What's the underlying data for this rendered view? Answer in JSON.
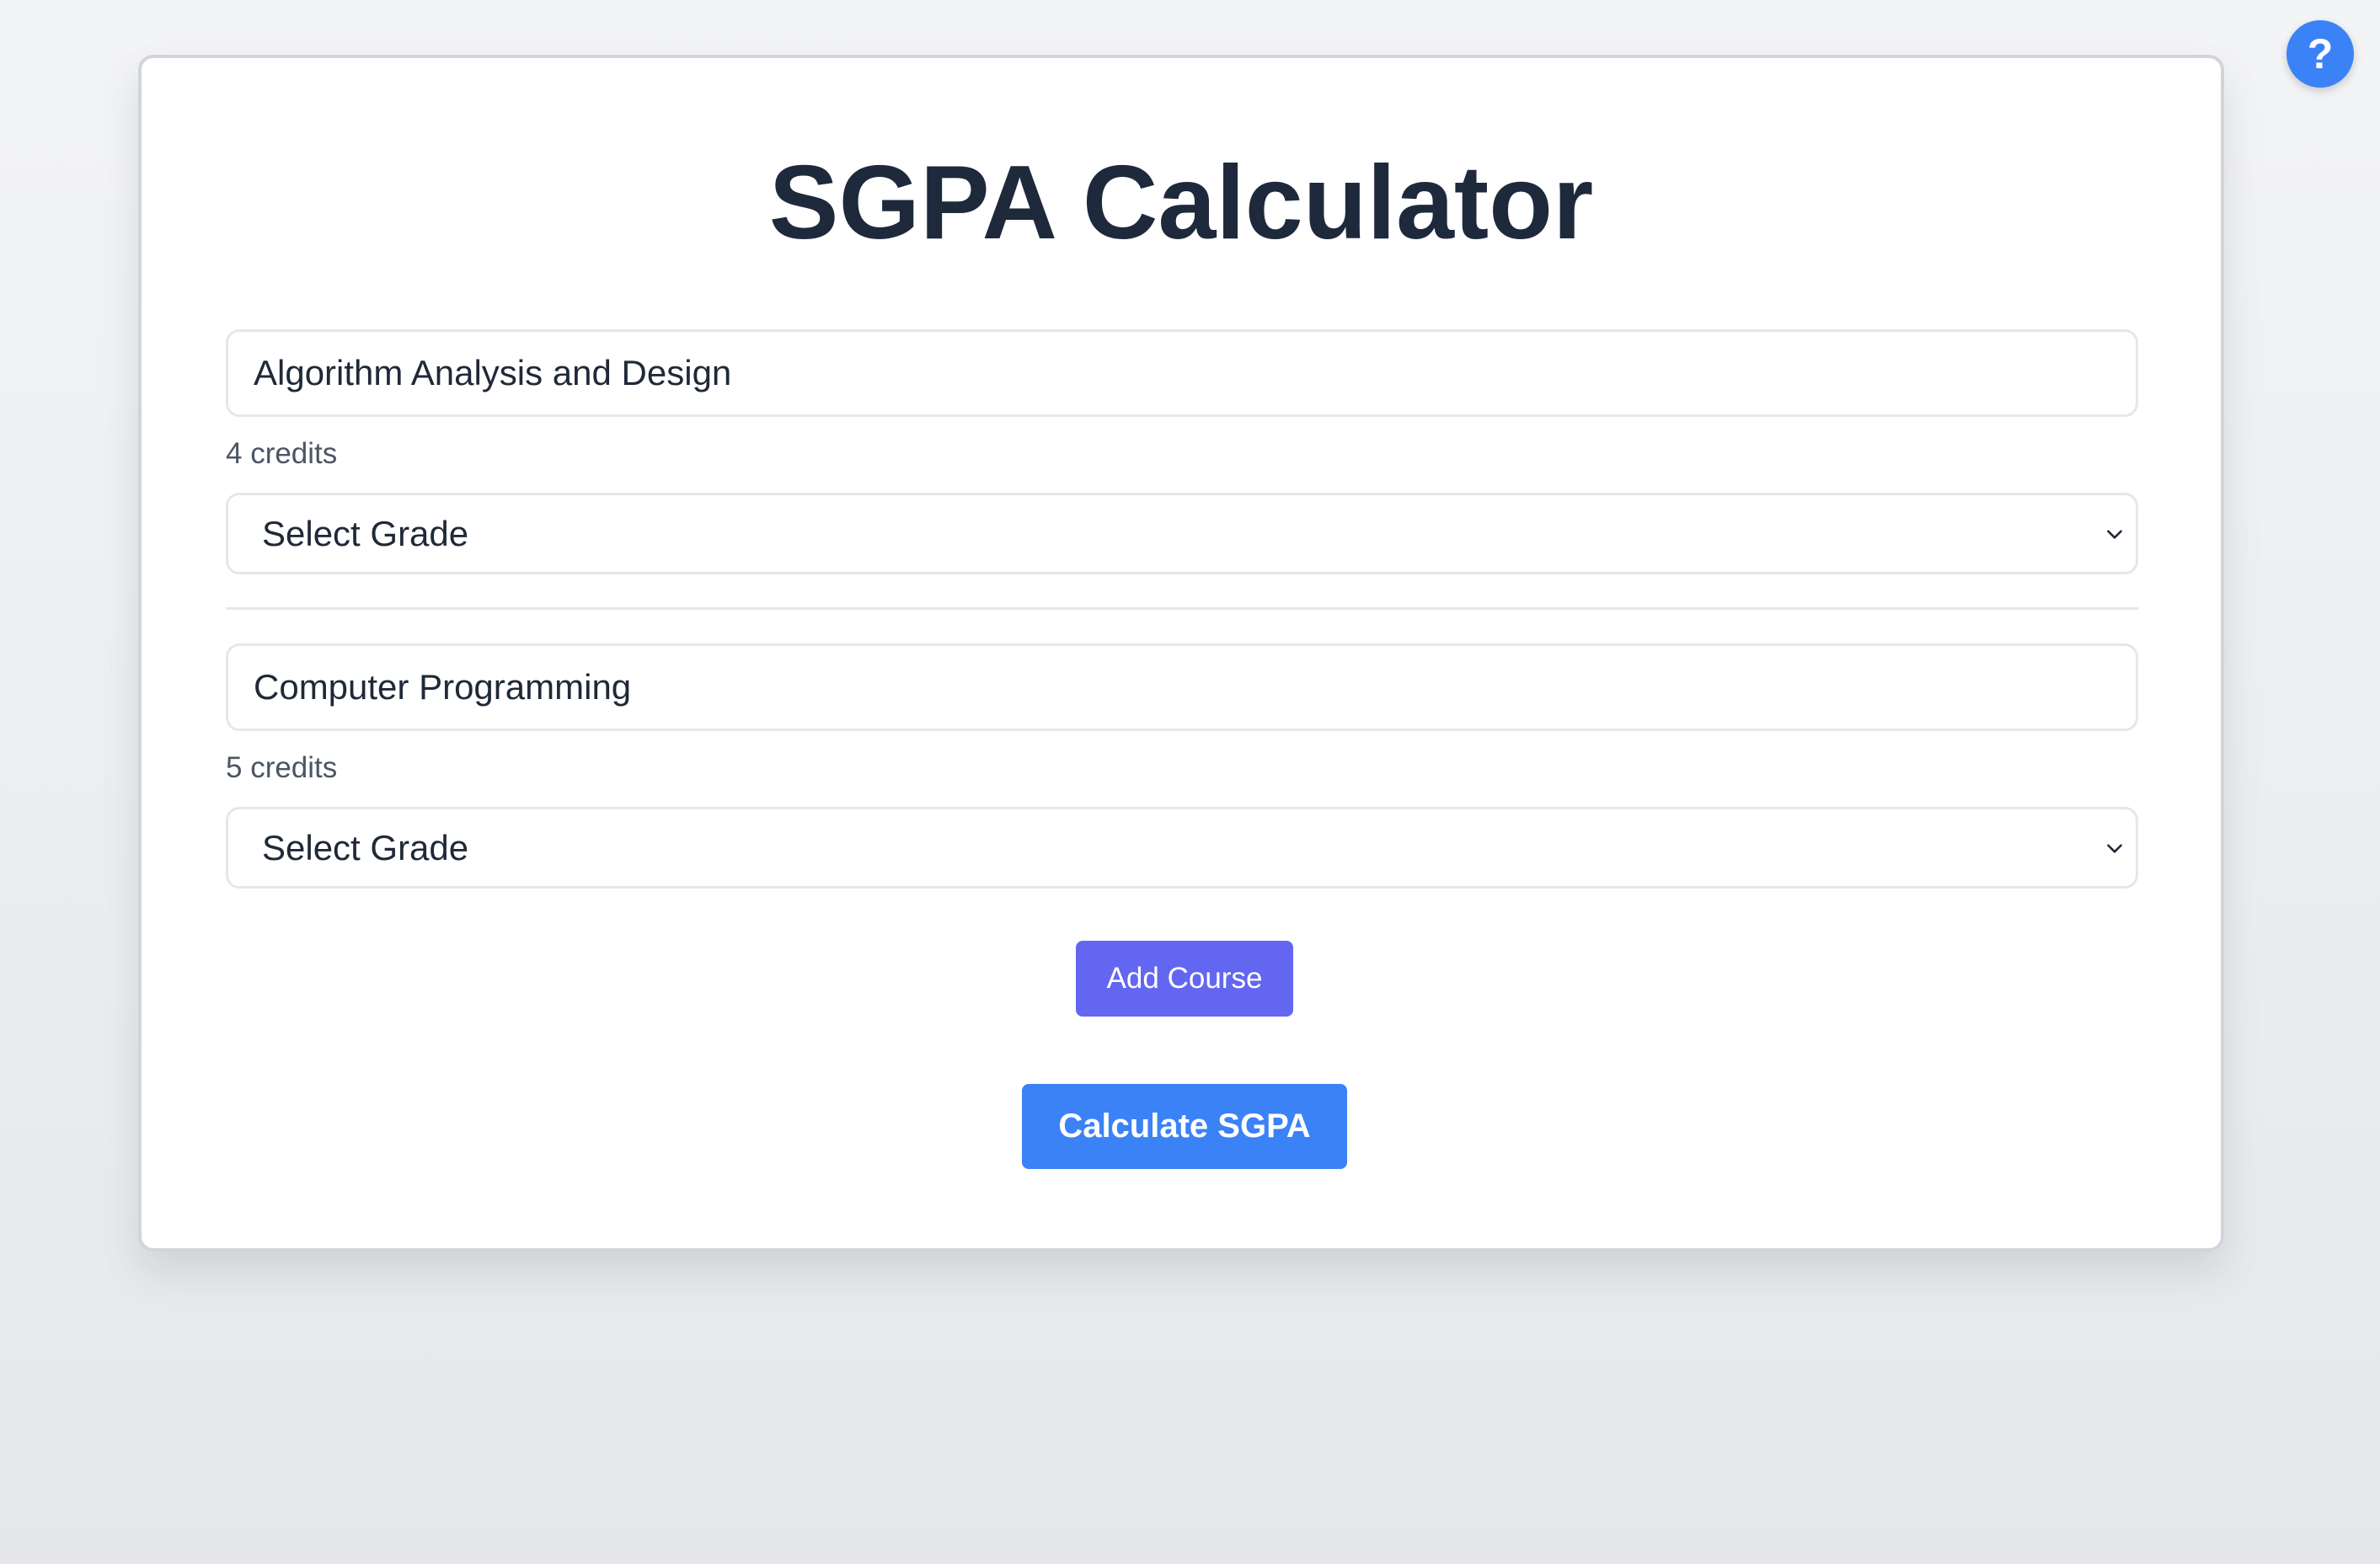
{
  "help_button": {
    "label": "?",
    "icon": "question-mark-icon",
    "color": "#3b82f6"
  },
  "title": "SGPA Calculator",
  "courses": [
    {
      "name": "Algorithm Analysis and Design",
      "credits_label": "4 credits",
      "grade_selected": "Select Grade"
    },
    {
      "name": "Computer Programming",
      "credits_label": "5 credits",
      "grade_selected": "Select Grade"
    }
  ],
  "buttons": {
    "add_course": "Add Course",
    "calculate": "Calculate SGPA"
  },
  "colors": {
    "add_button": "#6366f1",
    "calculate_button": "#3b82f6",
    "title_text": "#1e293b"
  }
}
